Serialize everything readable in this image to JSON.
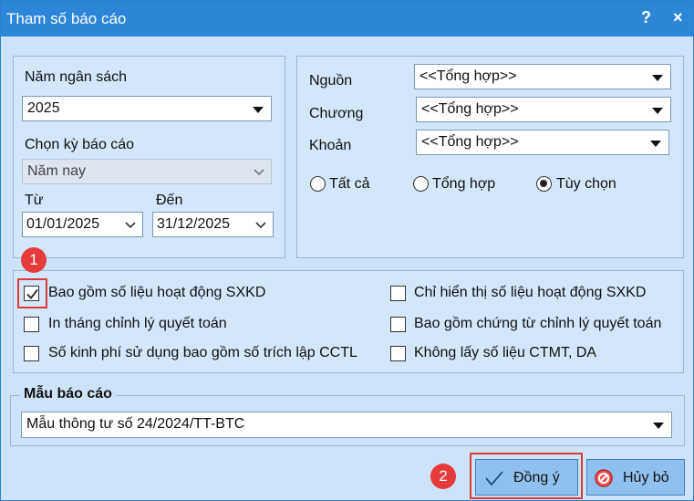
{
  "window": {
    "title": "Tham số báo cáo",
    "help": "?",
    "close": "×"
  },
  "left_panel": {
    "budget_year_label": "Năm ngân sách",
    "budget_year_value": "2025",
    "period_label": "Chọn kỳ báo cáo",
    "period_value": "Năm nay",
    "from_label": "Từ",
    "from_value": "01/01/2025",
    "to_label": "Đến",
    "to_value": "31/12/2025"
  },
  "right_panel": {
    "source_label": "Nguồn",
    "source_value": "<<Tổng hợp>>",
    "chapter_label": "Chương",
    "chapter_value": "<<Tổng hợp>>",
    "item_label": "Khoản",
    "item_value": "<<Tổng hợp>>",
    "radios": [
      {
        "label": "Tất cả",
        "selected": false
      },
      {
        "label": "Tổng hợp",
        "selected": false
      },
      {
        "label": "Tùy chọn",
        "selected": true
      }
    ]
  },
  "options": [
    {
      "label": "Bao gồm số liệu hoạt động SXKD",
      "checked": true
    },
    {
      "label": "In tháng chỉnh lý quyết toán",
      "checked": false
    },
    {
      "label": "Số kinh phí sử dụng bao gồm số trích lập CCTL",
      "checked": false
    },
    {
      "label": "Chỉ hiển thị số liệu hoạt động SXKD",
      "checked": false
    },
    {
      "label": "Bao gồm chứng từ chỉnh lý quyết toán",
      "checked": false
    },
    {
      "label": "Không lấy số liệu CTMT, DA",
      "checked": false
    }
  ],
  "template": {
    "legend": "Mẫu báo cáo",
    "value": "Mẫu thông tư số 24/2024/TT-BTC"
  },
  "buttons": {
    "ok": "Đồng ý",
    "cancel": "Hủy bỏ"
  },
  "annotations": {
    "step1": "1",
    "step2": "2"
  },
  "colors": {
    "titlebar": "#2d86d8",
    "panel": "#d4e6f9",
    "button": "#8ec1ef",
    "annotation": "#e63b3b"
  }
}
